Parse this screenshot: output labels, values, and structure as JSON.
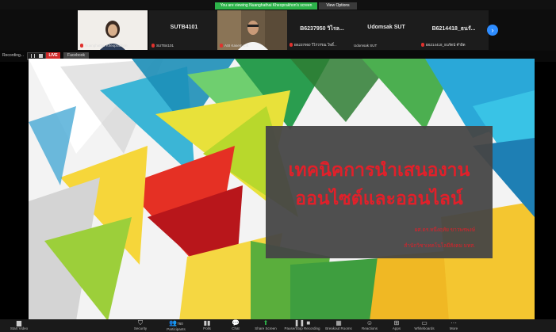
{
  "banner": {
    "viewing_text": "You are viewing Nuanghathai Kheoprakhon's screen",
    "view_options": "View Options"
  },
  "gallery": {
    "tiles": [
      {
        "name": "",
        "caption": "Nuanghathai Kheoprakhon"
      },
      {
        "name": "SUTB4101",
        "caption": "SUTB4101"
      },
      {
        "name": "",
        "caption": "ASI Kasem L.K"
      },
      {
        "name": "B6237950 วิไรล...",
        "caption": "B6237950 วิไรวรรณ โพธิ์..."
      },
      {
        "name": "Udomsak SUT",
        "caption": "Udomsak SUT"
      },
      {
        "name": "B6214418_ธนรั...",
        "caption": "B6214418_ธนรัตน์ คำผิด"
      }
    ]
  },
  "share": {
    "recording": "Recording...",
    "live": "LIVE",
    "facebook": "Facebook"
  },
  "slide": {
    "title_line1": "เทคนิคการนำเสนองาน",
    "title_line2": "ออนไซต์และออนไลน์",
    "author": "ผศ.ดร.หนึ่งฤทัย  ขาวพรพงษ์",
    "org": "สำนักวิชาเทคโนโลยีสังคม มทส."
  },
  "colors": {
    "accent": "#2d8cff",
    "title": "#e1202a",
    "green_banner": "#2db34a"
  },
  "toolbar": {
    "start_video": "Start Video",
    "security": "Security",
    "participants": "Participants",
    "participants_count": "760",
    "polls": "Polls",
    "chat": "Chat",
    "share_screen": "Share Screen",
    "pause_recording": "Pause/Stop Recording",
    "breakout": "Breakout Rooms",
    "reactions": "Reactions",
    "apps": "Apps",
    "whiteboards": "Whiteboards",
    "more": "More"
  }
}
